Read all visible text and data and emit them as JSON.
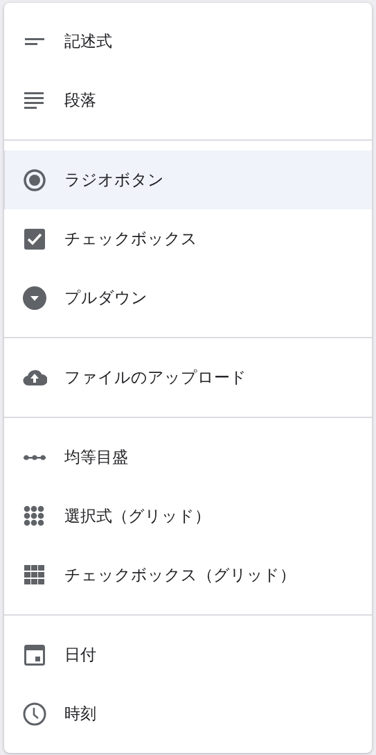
{
  "menu": {
    "groups": [
      {
        "items": [
          {
            "kind": "short",
            "label": "記述式",
            "selected": false
          },
          {
            "kind": "paragraph",
            "label": "段落",
            "selected": false
          }
        ]
      },
      {
        "items": [
          {
            "kind": "radio",
            "label": "ラジオボタン",
            "selected": true
          },
          {
            "kind": "checkbox",
            "label": "チェックボックス",
            "selected": false
          },
          {
            "kind": "dropdown",
            "label": "プルダウン",
            "selected": false
          }
        ]
      },
      {
        "items": [
          {
            "kind": "upload",
            "label": "ファイルのアップロード",
            "selected": false
          }
        ]
      },
      {
        "items": [
          {
            "kind": "scale",
            "label": "均等目盛",
            "selected": false
          },
          {
            "kind": "dotgrid",
            "label": "選択式（グリッド）",
            "selected": false
          },
          {
            "kind": "squaregrid",
            "label": "チェックボックス（グリッド）",
            "selected": false
          }
        ]
      },
      {
        "items": [
          {
            "kind": "date",
            "label": "日付",
            "selected": false
          },
          {
            "kind": "time",
            "label": "時刻",
            "selected": false
          }
        ]
      }
    ]
  }
}
